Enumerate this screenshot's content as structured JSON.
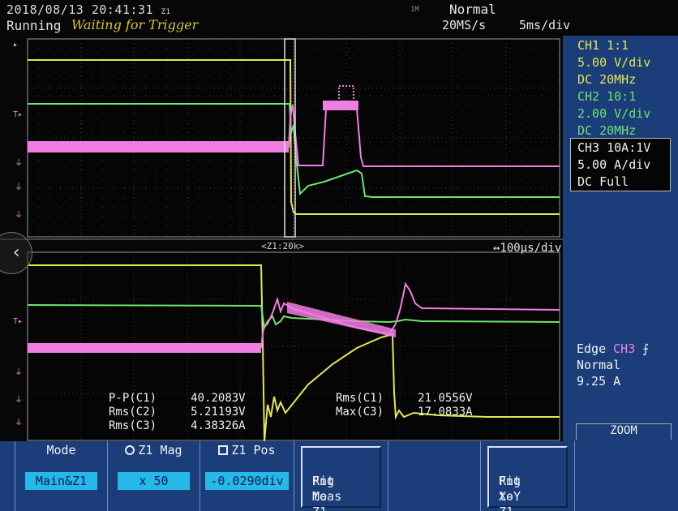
{
  "status": {
    "timestamp": "2018/08/13 20:41:31",
    "timestamp_marker": "Z1",
    "run_state": "Running",
    "trigger_state": "Waiting for Trigger",
    "memory_tag": "1M",
    "acq_mode": "Normal",
    "sample_rate": "20MS/s",
    "time_div": "5ms/div"
  },
  "channels": {
    "ch1": {
      "line1": "CH1 1:1",
      "line2": "5.00 V/div",
      "line3": "DC   20MHz",
      "color": "#e6e650"
    },
    "ch2": {
      "line1": "CH2 10:1",
      "line2": "2.00 V/div",
      "line3": "DC   20MHz",
      "color": "#6ee36e"
    },
    "ch3": {
      "line1": "CH3 10A:1V",
      "line2": "5.00 A/div",
      "line3": "DC   Full",
      "color": "#f07ee0"
    }
  },
  "trigger": {
    "type": "Edge",
    "source": "CH3",
    "mode": "Normal",
    "level": "9.25 A"
  },
  "zoom": {
    "label": "ZOOM",
    "ratio": "<Z1:20k>",
    "time_div": "↔100μs/div"
  },
  "measurements": [
    {
      "label": "P-P(C1)",
      "value": "40.2083V"
    },
    {
      "label": "Rms(C2)",
      "value": "5.21193V"
    },
    {
      "label": "Rms(C3)",
      "value": "4.38326A"
    },
    {
      "label": "Rms(C1)",
      "value": "21.0556V"
    },
    {
      "label": "Max(C3)",
      "value": "17.0833A"
    }
  ],
  "softkeys": {
    "mode_label": "Mode",
    "mode_value": "Main&Z1",
    "mag_label": "Z1 Mag",
    "mag_value": "x 50",
    "pos_label": "Z1 Pos",
    "pos_value": "-0.0290div",
    "fitmeas_line1": "Fit Meas",
    "fitmeas_line2": "Rng to Z1",
    "fitxy_line1": "Fit X-Y",
    "fitxy_line2": "Rng to Z1"
  },
  "colors": {
    "ch1": "#e6e650",
    "ch2": "#6ee36e",
    "ch3": "#f07ee0",
    "panel": "#1b3e7a",
    "highlight": "#25b8e8"
  }
}
